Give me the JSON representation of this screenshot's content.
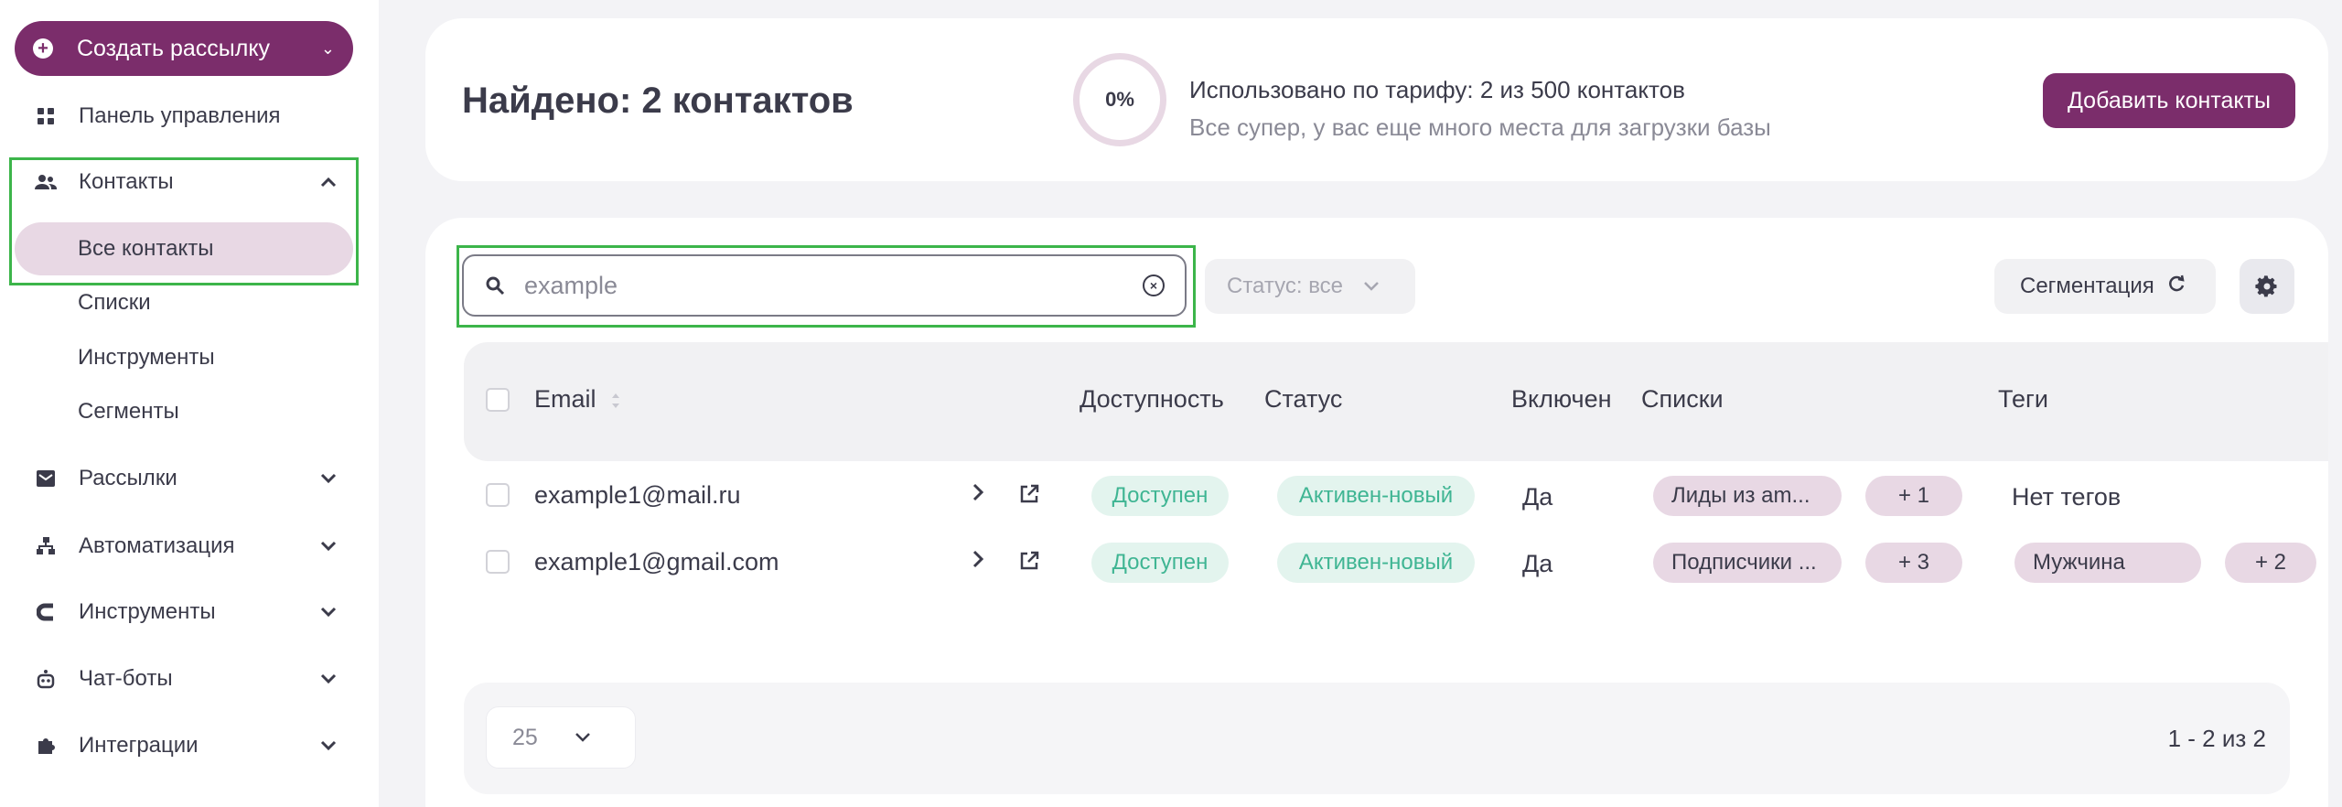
{
  "sidebar": {
    "create_button": "Создать рассылку",
    "items": [
      {
        "label": "Панель управления",
        "icon": "grid-icon"
      },
      {
        "label": "Контакты",
        "icon": "users-icon"
      },
      {
        "label": "Рассылки",
        "icon": "mail-icon"
      },
      {
        "label": "Автоматизация",
        "icon": "hierarchy-icon"
      },
      {
        "label": "Инструменты",
        "icon": "magnet-icon"
      },
      {
        "label": "Чат-боты",
        "icon": "bot-icon"
      },
      {
        "label": "Интеграции",
        "icon": "puzzle-icon"
      }
    ],
    "contacts_sub": [
      "Все контакты",
      "Списки",
      "Инструменты",
      "Сегменты"
    ]
  },
  "header": {
    "found_title": "Найдено: 2 контактов",
    "progress": "0%",
    "usage_line1": "Использовано по тарифу: 2 из 500 контактов",
    "usage_line2": "Все супер, у вас еще много места для загрузки базы",
    "add_button": "Добавить контакты"
  },
  "toolbar": {
    "search_value": "example",
    "status_filter": "Статус: все",
    "segmentation": "Сегментация"
  },
  "table": {
    "headers": {
      "email": "Email",
      "availability": "Доступность",
      "status": "Статус",
      "enabled": "Включен",
      "lists": "Списки",
      "tags": "Теги"
    },
    "rows": [
      {
        "email": "example1@mail.ru",
        "availability": "Доступен",
        "status": "Активен-новый",
        "enabled": "Да",
        "list": "Лиды из am...",
        "list_more": "+ 1",
        "tag": "Нет тегов",
        "tag_more": ""
      },
      {
        "email": "example1@gmail.com",
        "availability": "Доступен",
        "status": "Активен-новый",
        "enabled": "Да",
        "list": "Подписчики ...",
        "list_more": "+ 3",
        "tag": "Мужчина",
        "tag_more": "+ 2"
      }
    ]
  },
  "footer": {
    "per_page": "25",
    "pagination": "1 - 2 из 2"
  },
  "colors": {
    "brand": "#7b2d6b",
    "accent_light": "#e8d8e4",
    "success": "#3fb593",
    "highlight": "#3cb54a"
  }
}
